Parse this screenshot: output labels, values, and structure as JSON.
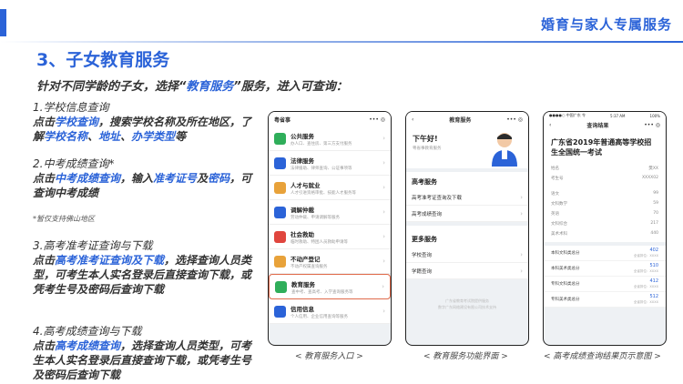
{
  "header": {
    "title": "婚育与家人专属服务"
  },
  "section": {
    "title": "3、子女教育服务"
  },
  "intro": {
    "p1": "针对不同学龄的子女，选择",
    "q1": "“",
    "hl": "教育服务",
    "q2": "”",
    "p2": "服务，进入可查询："
  },
  "blocks": {
    "b1": {
      "title": "1.学校信息查询",
      "t1": " 点击",
      "h1": "学校查询",
      "t2": "，搜索学校名称及所在地区，了解",
      "h2": "学校名称",
      "t3": "、",
      "h3": "地址",
      "t4": "、",
      "h4": "办学类型",
      "t5": "等"
    },
    "b2": {
      "title": "2.中考成绩查询*",
      "t1": "点击",
      "h1": "中考成绩查询",
      "t2": "，输入",
      "h2": "准考证号",
      "t3": "及",
      "h3": "密码",
      "t4": "，可查询中考成绩"
    },
    "note": "*暂仅支持佛山地区",
    "b3": {
      "title": "3.高考准考证查询与下载",
      "t1": "点击",
      "h1": "高考准考证查询及下载",
      "t2": "，选择查询人员类型，可考生本人实名登录后直接查询下载，或凭考生号及密码后查询下载"
    },
    "b4": {
      "title": "4.高考成绩查询与下载",
      "t1": "点击",
      "h1": "高考成绩查询",
      "t2": "，选择查询人员类型，可考生本人实名登录后直接查询下载，或凭考生号及密码后查询下载"
    }
  },
  "phone1": {
    "app": "粤省事",
    "items": [
      {
        "label": "公共服务",
        "sub": "办人口、查住房、第三方支付服务",
        "color": "#2fae5a"
      },
      {
        "label": "法律服务",
        "sub": "法律援助、律师查询、公证事项等",
        "color": "#2b63d8"
      },
      {
        "label": "人才与就业",
        "sub": "人才引进资格审批、技能人才服务等",
        "color": "#e8a23a"
      },
      {
        "label": "调解仲裁",
        "sub": "劳动仲裁、申请调解等服务",
        "color": "#2b63d8"
      },
      {
        "label": "社会救助",
        "sub": "临时救助、特困人员救助申请等",
        "color": "#e0463e"
      },
      {
        "label": "不动产登记",
        "sub": "不动产权属查询服务",
        "color": "#e8a23a"
      },
      {
        "label": "教育服务",
        "sub": "查中考、查高考、入学查询服务等",
        "color": "#2fae5a"
      },
      {
        "label": "信用信息",
        "sub": "个人信用、企业信用查询等服务",
        "color": "#2b63d8"
      }
    ]
  },
  "phone2": {
    "nav": "教育服务",
    "greet": "下午好!",
    "greet_sub": "粤省事教育服务",
    "gk_title": "高考服务",
    "gk_items": [
      "高考准考证查询及下载",
      "高考成绩查询"
    ],
    "more_title": "更多服务",
    "more_items": [
      "学校查询",
      "学籍查询"
    ],
    "footer1": "广东省教育考试院提供服务",
    "footer2": "数字广东网络建设有限公司技术支持"
  },
  "phone3": {
    "status_left": "●●●●○ 中国广东 令",
    "status_time": "5:37 AM",
    "status_right": "100%",
    "nav": "查询结果",
    "title": "广东省2019年普通高等学校招生全国统一考试",
    "kv": [
      [
        "姓名",
        "樊XX"
      ],
      [
        "考生号",
        "XXXX02"
      ],
      [
        "语文",
        "99"
      ],
      [
        "文科数学",
        "59"
      ],
      [
        "英语",
        "70"
      ],
      [
        "文科综合",
        "217"
      ],
      [
        "美术术科",
        "440"
      ]
    ],
    "scores": [
      [
        "本科文科类总分",
        "402",
        "全省排位：XXXX"
      ],
      [
        "本科美术类总分",
        "510",
        "全省排位：XXXX"
      ],
      [
        "专科文科类总分",
        "412",
        "全省排位：XXXX"
      ],
      [
        "专科美术类总分",
        "512",
        "全省排位：XXXX"
      ]
    ]
  },
  "captions": {
    "c1": "< 教育服务入口 >",
    "c2": "< 教育服务功能界面 >",
    "c3": "< 高考成绩查询结果页示意图 >"
  }
}
